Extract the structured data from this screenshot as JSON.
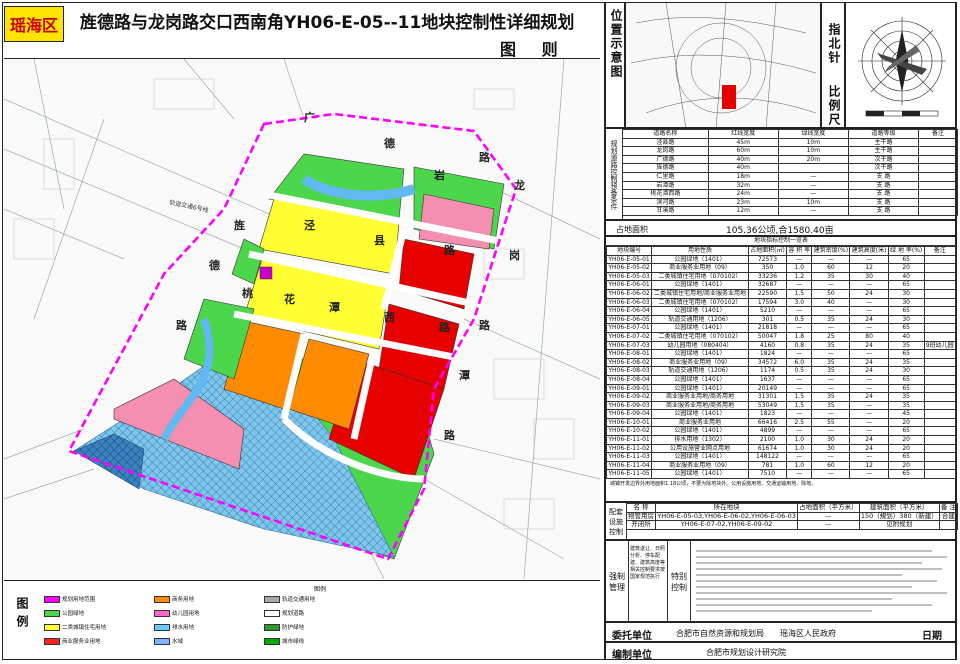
{
  "header": {
    "district": "瑶海区",
    "title": "旌德路与龙岗路交口西南角YH06-E-05--11地块控制性详细规划",
    "subtitle": "图 则"
  },
  "map_labels": {
    "roads": [
      "龙",
      "岗",
      "路",
      "旌",
      "德",
      "路",
      "泾",
      "县",
      "路",
      "桃",
      "花",
      "潭",
      "西",
      "路",
      "广",
      "德",
      "路",
      "岩",
      "潭",
      "路",
      "溪",
      "路"
    ],
    "rail": "轨道交通6号线"
  },
  "side_panels": {
    "location_title": "位置示意图",
    "north_title": "指北针",
    "scale_title": "比例尺"
  },
  "road_table": {
    "group_label": "规划道路控制预备条件",
    "headers": [
      "道路名称",
      "红线宽度",
      "绿线宽度",
      "道路等级",
      "备注"
    ],
    "rows": [
      [
        "泾县路",
        "45m",
        "10m",
        "主干路",
        ""
      ],
      [
        "龙岗路",
        "60m",
        "10m",
        "主干路",
        ""
      ],
      [
        "广德路",
        "40m",
        "20m",
        "次干路",
        ""
      ],
      [
        "旌德路",
        "40m",
        "",
        "次干路",
        ""
      ],
      [
        "仁里路",
        "18m",
        "—",
        "支 路",
        ""
      ],
      [
        "岩潭路",
        "32m",
        "—",
        "支 路",
        ""
      ],
      [
        "桃花潭西路",
        "24m",
        "—",
        "支 路",
        ""
      ],
      [
        "滨河路",
        "23m",
        "10m",
        "支 路",
        ""
      ],
      [
        "甘溪路",
        "12m",
        "—",
        "支 路",
        ""
      ]
    ]
  },
  "area": {
    "label": "占地面积",
    "value": "105.36公顷,合1580.40亩"
  },
  "parcel_table": {
    "caption": "地块指标控制一览表",
    "headers": [
      "地块编号",
      "用地性质",
      "占地面积(㎡)",
      "容 积 率",
      "建筑密度(%)",
      "建筑高度(米)",
      "绿 地 率(%)",
      "备注"
    ],
    "rows": [
      [
        "YH06-E-05-01",
        "公园绿地（1401）",
        "72573",
        "—",
        "—",
        "—",
        "65",
        ""
      ],
      [
        "YH06-E-05-02",
        "商业服务业用地（09）",
        "350",
        "1.0",
        "60",
        "12",
        "20",
        ""
      ],
      [
        "YH06-E-05-03",
        "二类城镇住宅用地（070102）",
        "33236",
        "1.2",
        "35",
        "30",
        "40",
        ""
      ],
      [
        "YH06-E-06-01",
        "公园绿地（1401）",
        "32687",
        "—",
        "—",
        "—",
        "65",
        ""
      ],
      [
        "YH06-E-06-02",
        "二类城镇住宅用地/商业服务业用地",
        "22590",
        "1.5",
        "50",
        "24",
        "30",
        ""
      ],
      [
        "YH06-E-06-03",
        "二类城镇住宅用地（070102）",
        "17594",
        "3.0",
        "40",
        "—",
        "30",
        ""
      ],
      [
        "YH06-E-06-04",
        "公园绿地（1401）",
        "5210",
        "—",
        "—",
        "—",
        "65",
        ""
      ],
      [
        "YH06-E-06-05",
        "轨道交通用地（1206）",
        "301",
        "0.5",
        "35",
        "24",
        "30",
        ""
      ],
      [
        "YH06-E-07-01",
        "公园绿地（1401）",
        "21818",
        "—",
        "—",
        "—",
        "65",
        ""
      ],
      [
        "YH06-E-07-02",
        "二类城镇住宅用地（070102）",
        "50047",
        "1.8",
        "25",
        "80",
        "40",
        ""
      ],
      [
        "YH06-E-07-03",
        "幼儿园用地（080404）",
        "4160",
        "0.8",
        "35",
        "24",
        "35",
        "9班幼儿园"
      ],
      [
        "YH06-E-08-01",
        "公园绿地（1401）",
        "1824",
        "—",
        "—",
        "—",
        "65",
        ""
      ],
      [
        "YH06-E-08-02",
        "商业服务业用地（09）",
        "34572",
        "6.0",
        "35",
        "24",
        "35",
        ""
      ],
      [
        "YH06-E-08-03",
        "轨道交通用地（1206）",
        "1174",
        "0.5",
        "35",
        "24",
        "30",
        ""
      ],
      [
        "YH06-E-08-04",
        "公园绿地（1401）",
        "1637",
        "—",
        "—",
        "—",
        "65",
        ""
      ],
      [
        "YH06-E-09-01",
        "公园绿地（1401）",
        "20149",
        "—",
        "—",
        "—",
        "65",
        ""
      ],
      [
        "YH06-E-09-02",
        "商业服务业用地/商务用地",
        "31301",
        "1.5",
        "35",
        "24",
        "35",
        ""
      ],
      [
        "YH06-E-09-03",
        "商业服务业用地/商务用地",
        "53049",
        "1.5",
        "35",
        "—",
        "35",
        ""
      ],
      [
        "YH06-E-09-04",
        "公园绿地（1401）",
        "1823",
        "—",
        "—",
        "—",
        "45",
        ""
      ],
      [
        "YH06-E-10-01",
        "商业服务业用地",
        "66416",
        "2.5",
        "55",
        "—",
        "20",
        ""
      ],
      [
        "YH06-E-10-02",
        "公园绿地（1401）",
        "4899",
        "—",
        "—",
        "—",
        "65",
        ""
      ],
      [
        "YH06-E-11-01",
        "排水用地（1302）",
        "2100",
        "1.0",
        "30",
        "24",
        "20",
        ""
      ],
      [
        "YH06-E-11-02",
        "公用设施营业网点用地",
        "61674",
        "1.0",
        "30",
        "24",
        "20",
        ""
      ],
      [
        "YH06-E-11-03",
        "公园绿地（1401）",
        "148122",
        "—",
        "—",
        "—",
        "65",
        ""
      ],
      [
        "YH06-E-11-04",
        "商业服务业用地（09）",
        "781",
        "1.0",
        "60",
        "12",
        "20",
        ""
      ],
      [
        "YH06-E-11-05",
        "公园绿地（1401）",
        "7510",
        "—",
        "—",
        "—",
        "65",
        ""
      ]
    ],
    "note": "城镇开发边界外用地面积1.18公顷，不要为除地块外、公用设施用地、交通运输用地、除地。"
  },
  "facility_table": {
    "group_label": "配套设施控制",
    "headers": [
      "名 称",
      "所在地块",
      "占地面积（平方米）",
      "建筑面积（平方米）",
      "备 注"
    ],
    "rows": [
      [
        "物管用房",
        "YH06-E-05-03,YH06-E-06-02,YH06-E-06-03",
        "—",
        "150（規划）380（新建）",
        "合建"
      ],
      [
        "开闭所",
        "YH06-E-07-02,YH06-E-09-02",
        "—",
        "见附规划",
        ""
      ]
    ]
  },
  "notes_section": {
    "label_left": "强制管理",
    "label_mid": "建筑退让、日照分析、停车配建、建筑高度等相关控制要求按国家规范执行",
    "label_right": "特别控制"
  },
  "footer": {
    "client_label": "委托单位",
    "client_value": "合肥市自然资源和规划局　　瑶海区人民政府",
    "date_label": "日期",
    "maker_label": "编制单位",
    "maker_value": "合肥市规划设计研究院"
  },
  "legend": {
    "title": "图例",
    "caption": "图例",
    "items": [
      {
        "label": "规划用地范围",
        "color": "#ff00ff"
      },
      {
        "label": "公园绿地",
        "color": "#4cd64c"
      },
      {
        "label": "二类城镇住宅用地",
        "color": "#ffff33"
      },
      {
        "label": "商业服务业用地",
        "color": "#ff2020"
      },
      {
        "label": "商务用地",
        "color": "#ff8c00"
      },
      {
        "label": "幼儿园用地",
        "color": "#ff66cc"
      },
      {
        "label": "排水用地",
        "color": "#66ccff"
      },
      {
        "label": "水域",
        "color": "#7fb2ff"
      },
      {
        "label": "轨道交通用地",
        "color": "#aaaaaa"
      },
      {
        "label": "规划道路",
        "color": "#ffffff"
      },
      {
        "label": "防护绿地",
        "color": "#2a9a2a"
      },
      {
        "label": "城市绿线",
        "color": "#00aa00"
      }
    ]
  },
  "colors": {
    "boundary": "#ff00ff",
    "park": "#4cd64c",
    "residential": "#ffff33",
    "commercial": "#e60000",
    "business": "#ff8c00",
    "pink": "#f48fb1",
    "water": "#62b8f0",
    "hatch": "#5aa9d8"
  }
}
